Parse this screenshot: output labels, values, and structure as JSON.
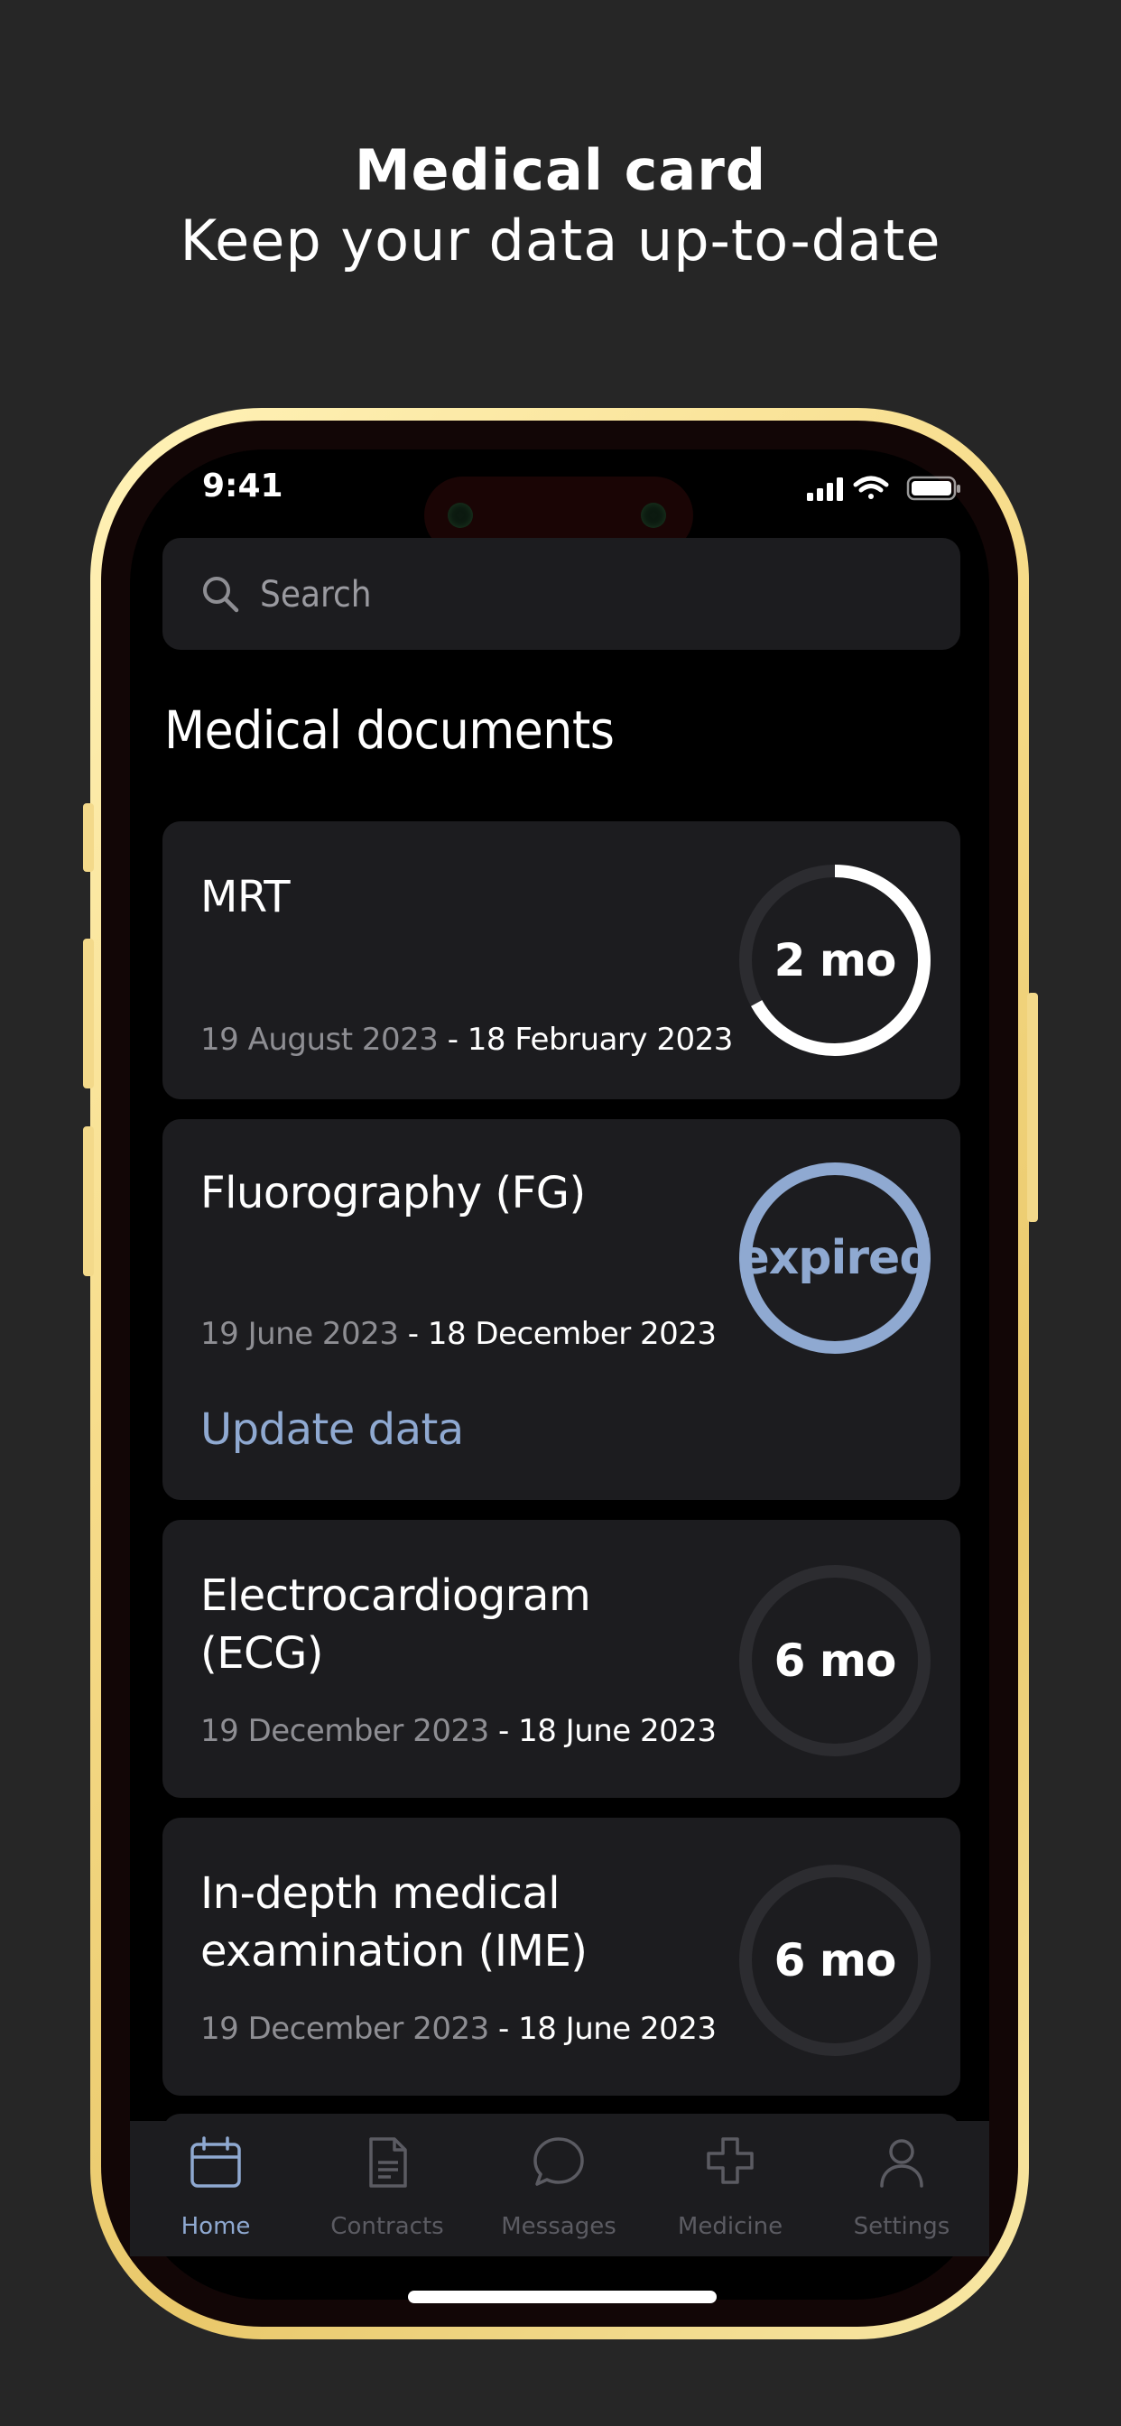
{
  "headline": {
    "title": "Medical card",
    "subtitle": "Keep your data up-to-date"
  },
  "status_bar": {
    "time": "9:41"
  },
  "search": {
    "placeholder": "Search"
  },
  "section_title": "Medical documents",
  "documents": [
    {
      "title": "MRT",
      "date_start": "19 August 2023",
      "date_end": "18 February 2023",
      "badge": "2 mo",
      "progress": 0.67,
      "state": "active"
    },
    {
      "title": "Fluorography (FG)",
      "date_start": "19 June 2023",
      "date_end": "18 December 2023",
      "badge": "expired",
      "progress": 1.0,
      "state": "expired",
      "action": "Update data"
    },
    {
      "title": "Electrocardiogram (ECG)",
      "date_start": "19 December 2023",
      "date_end": "18 June 2023",
      "badge": "6 mo",
      "progress": 0,
      "state": "full"
    },
    {
      "title": "In-depth medical examination (IME)",
      "date_start": "19 December 2023",
      "date_end": "18 June 2023",
      "badge": "6 mo",
      "progress": 0,
      "state": "full"
    }
  ],
  "date_separator": " - ",
  "tabs": [
    {
      "label": "Home",
      "icon": "calendar-icon",
      "active": true
    },
    {
      "label": "Contracts",
      "icon": "document-icon",
      "active": false
    },
    {
      "label": "Messages",
      "icon": "chat-bubble-icon",
      "active": false
    },
    {
      "label": "Medicine",
      "icon": "medical-cross-icon",
      "active": false
    },
    {
      "label": "Settings",
      "icon": "person-icon",
      "active": false
    }
  ],
  "colors": {
    "background": "#262626",
    "card": "#1c1c1f",
    "accent": "#8fa9d1",
    "ring_track": "#2c2c30",
    "frame_gold": "#f7dd8c"
  }
}
